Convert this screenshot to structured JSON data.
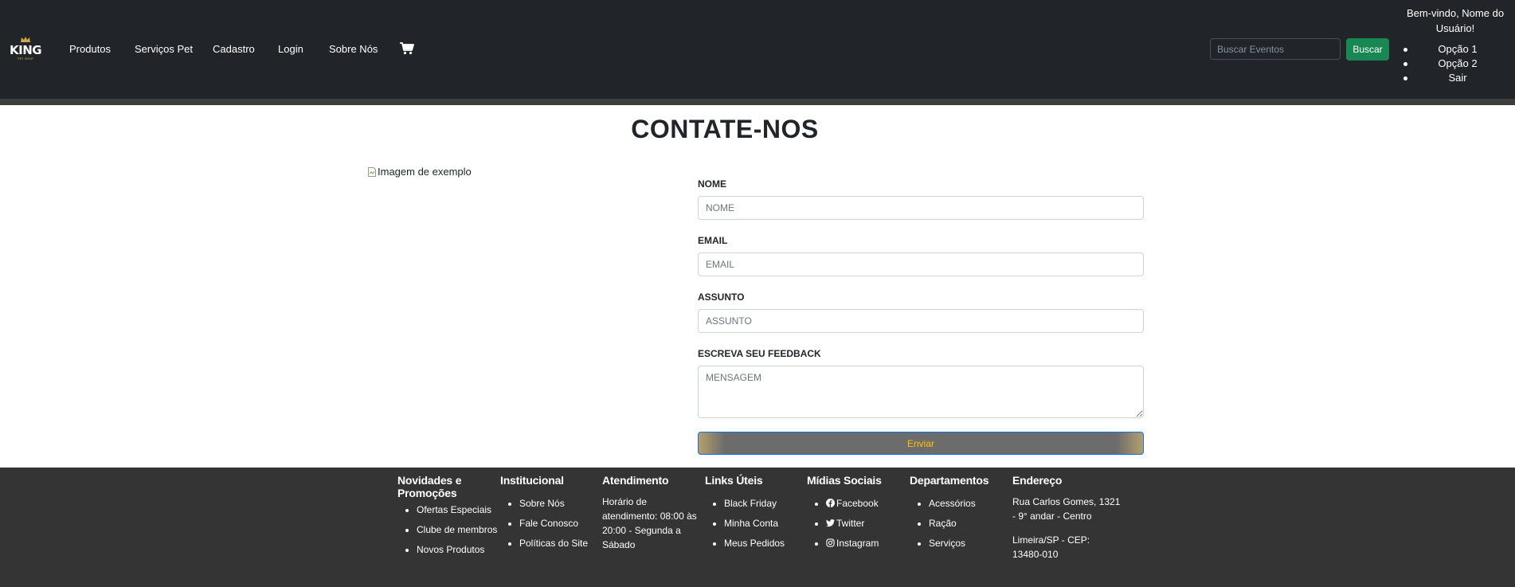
{
  "navbar": {
    "logo": {
      "text": "KING",
      "subtext": "PET SHOP"
    },
    "links": [
      "Produtos",
      "Serviços Pet",
      "Cadastro",
      "Login",
      "Sobre Nós"
    ],
    "cart_icon": "cart-icon",
    "search": {
      "placeholder": "Buscar Eventos",
      "button": "Buscar"
    },
    "welcome": "Bem-vindo, Nome do Usuário!",
    "user_menu": [
      "Opção 1",
      "Opção 2",
      "Sair"
    ]
  },
  "main": {
    "title": "CONTATE-NOS",
    "image_alt": "Imagem de exemplo",
    "form": {
      "name_label": "NOME",
      "name_placeholder": "NOME",
      "email_label": "EMAIL",
      "email_placeholder": "EMAIL",
      "subject_label": "ASSUNTO",
      "subject_placeholder": "ASSUNTO",
      "feedback_label": "ESCREVA SEU FEEDBACK",
      "feedback_placeholder": "MENSAGEM",
      "submit": "Enviar"
    }
  },
  "footer": {
    "promos": {
      "title": "Novidades e Promoções",
      "items": [
        "Ofertas Especiais",
        "Clube de membros",
        "Novos Produtos"
      ]
    },
    "institucional": {
      "title": "Institucional",
      "items": [
        "Sobre Nós",
        "Fale Conosco",
        "Políticas do Site"
      ]
    },
    "atendimento": {
      "title": "Atendimento",
      "text": "Horário de atendimento: 08:00 às 20:00 - Segunda a Sábado"
    },
    "links": {
      "title": "Links Úteis",
      "items": [
        "Black Friday",
        "Minha Conta",
        "Meus Pedidos"
      ]
    },
    "social": {
      "title": "Mídias Sociais",
      "items": [
        "Facebook",
        "Twitter",
        "Instagram"
      ]
    },
    "departamentos": {
      "title": "Departamentos",
      "items": [
        "Acessórios",
        "Ração",
        "Serviços"
      ]
    },
    "endereco": {
      "title": "Endereço",
      "line1": "Rua Carlos Gomes, 1321 - 9° andar - Centro",
      "line2": "Limeira/SP - CEP: 13480-010"
    }
  },
  "colors": {
    "navbar_bg": "#212529",
    "footer_bg": "#343434",
    "search_button": "#198754",
    "submit_text": "#ffc107"
  }
}
